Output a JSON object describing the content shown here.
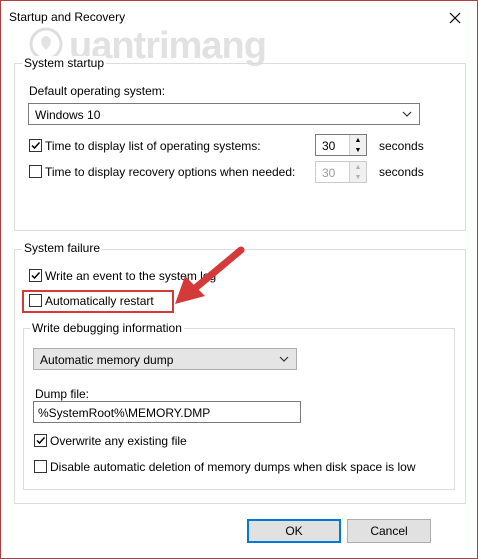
{
  "window": {
    "title": "Startup and Recovery"
  },
  "watermark": {
    "text": "uantrimang"
  },
  "system_startup": {
    "group_label": "System startup",
    "default_os_label": "Default operating system:",
    "default_os_value": "Windows 10",
    "display_list": {
      "label": "Time to display list of operating systems:",
      "checked": true,
      "value": "30",
      "unit": "seconds"
    },
    "display_recovery": {
      "label": "Time to display recovery options when needed:",
      "checked": false,
      "value": "30",
      "unit": "seconds"
    }
  },
  "system_failure": {
    "group_label": "System failure",
    "write_event": {
      "label": "Write an event to the system log",
      "checked": true
    },
    "auto_restart": {
      "label": "Automatically restart",
      "checked": false
    },
    "debug_group_label": "Write debugging information",
    "dump_type_value": "Automatic memory dump",
    "dump_file_label": "Dump file:",
    "dump_file_value": "%SystemRoot%\\MEMORY.DMP",
    "overwrite": {
      "label": "Overwrite any existing file",
      "checked": true
    },
    "disable_deletion": {
      "label": "Disable automatic deletion of memory dumps when disk space is low",
      "checked": false
    }
  },
  "buttons": {
    "ok": "OK",
    "cancel": "Cancel"
  },
  "colors": {
    "annotation_red": "#d43a3a",
    "accent_blue": "#0078d7"
  }
}
